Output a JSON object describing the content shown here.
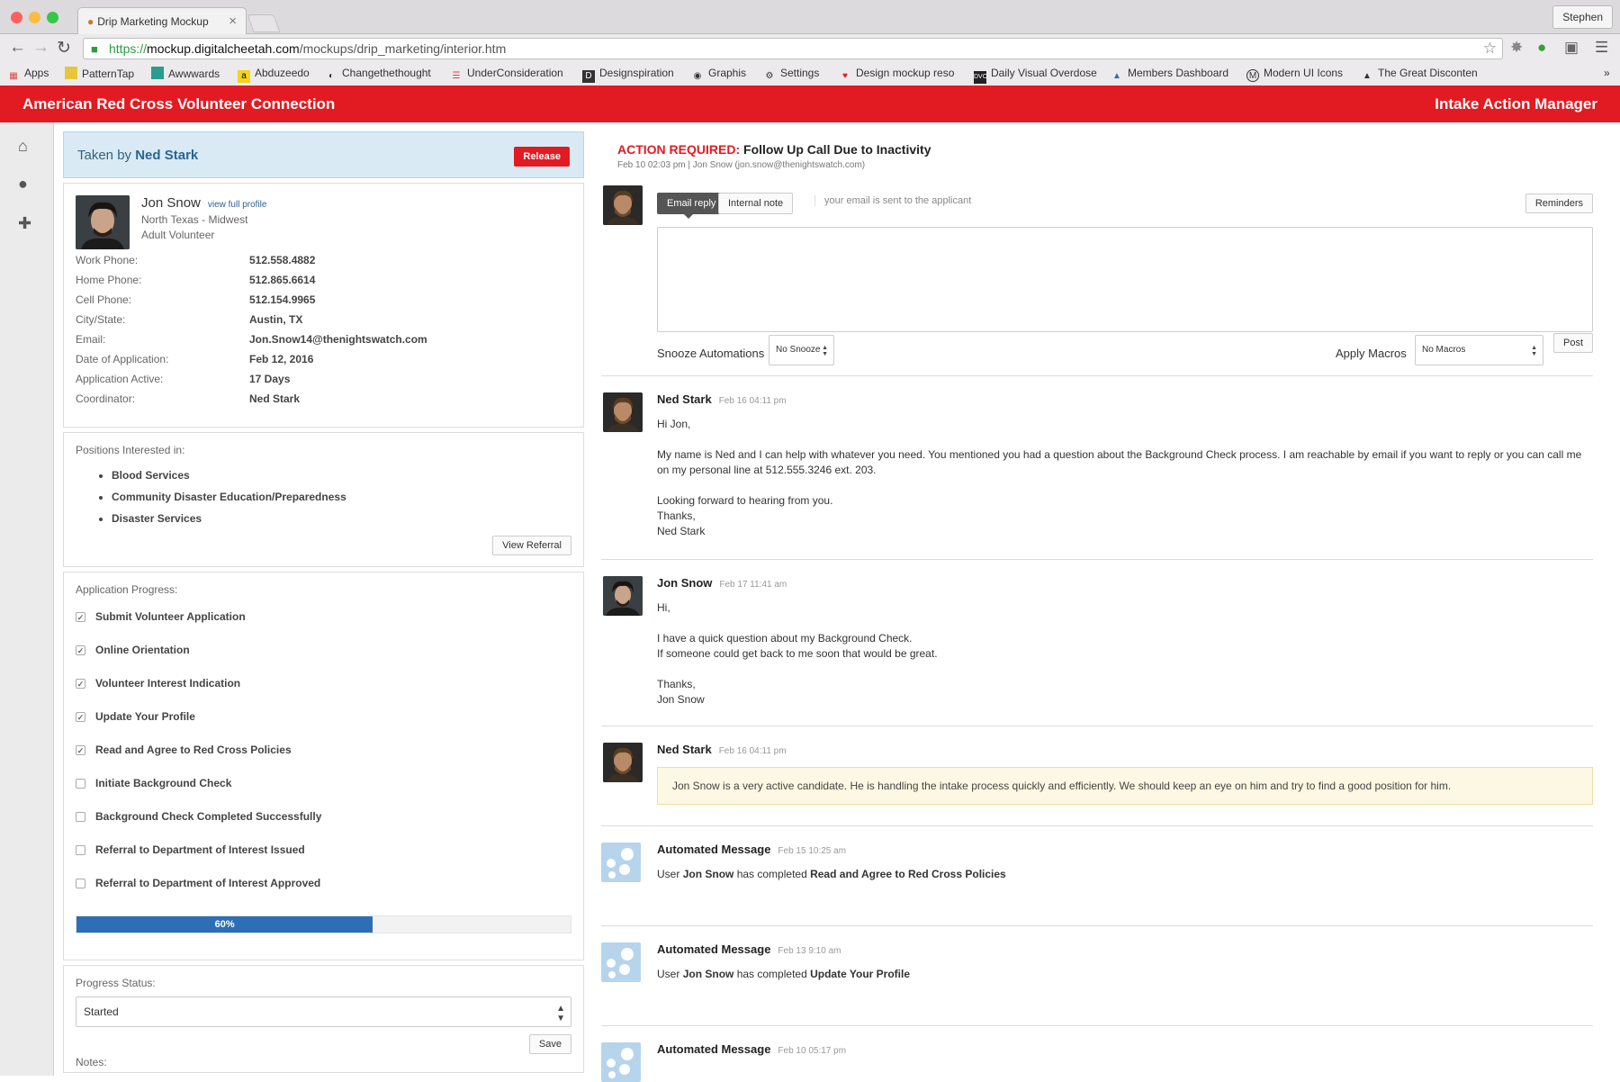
{
  "browser": {
    "tab_title": "Drip Marketing Mockup",
    "user_button": "Stephen",
    "url_scheme": "https://",
    "url_domain": "mockup.digitalcheetah.com",
    "url_path": "/mockups/drip_marketing/interior.htm",
    "bookmarks": [
      "Apps",
      "PatternTap",
      "Awwwards",
      "Abduzeedo",
      "Changethethought",
      "UnderConsideration",
      "Designspiration",
      "Graphis",
      "Settings",
      "Design mockup reso",
      "Daily Visual Overdose",
      "Members Dashboard",
      "Modern UI Icons",
      "The Great Disconten"
    ],
    "bookmarks_more": "»"
  },
  "app": {
    "title": "American Red Cross Volunteer Connection",
    "module": "Intake Action Manager"
  },
  "taken": {
    "prefix": "Taken by",
    "name": "Ned Stark",
    "release_label": "Release"
  },
  "applicant": {
    "name": "Jon Snow",
    "view_profile": "view full profile",
    "region": "North Texas - Midwest",
    "role": "Adult Volunteer",
    "fields": [
      {
        "label": "Work Phone:",
        "value": "512.558.4882"
      },
      {
        "label": "Home Phone:",
        "value": "512.865.6614"
      },
      {
        "label": "Cell Phone:",
        "value": "512.154.9965"
      },
      {
        "label": "City/State:",
        "value": "Austin, TX"
      },
      {
        "label": "Email:",
        "value": "Jon.Snow14@thenightswatch.com"
      },
      {
        "label": "Date of Application:",
        "value": "Feb 12, 2016"
      },
      {
        "label": "Application Active:",
        "value": "17 Days"
      },
      {
        "label": "Coordinator:",
        "value": "Ned Stark"
      }
    ]
  },
  "positions": {
    "title": "Positions Interested in:",
    "items": [
      "Blood Services",
      "Community Disaster Education/Preparedness",
      "Disaster Services"
    ],
    "button": "View Referral"
  },
  "progress": {
    "title": "Application Progress:",
    "steps": [
      {
        "label": "Submit Volunteer Application",
        "checked": true
      },
      {
        "label": "Online Orientation",
        "checked": true
      },
      {
        "label": "Volunteer Interest Indication",
        "checked": true
      },
      {
        "label": "Update Your Profile",
        "checked": true
      },
      {
        "label": "Read and Agree to Red Cross Policies",
        "checked": true
      },
      {
        "label": "Initiate Background Check",
        "checked": false
      },
      {
        "label": "Background Check Completed Successfully",
        "checked": false
      },
      {
        "label": "Referral to Department of Interest Issued",
        "checked": false
      },
      {
        "label": "Referral to Department of Interest Approved",
        "checked": false
      }
    ],
    "percent": 60,
    "percent_label": "60%"
  },
  "status": {
    "title": "Progress Status:",
    "selected": "Started",
    "save_label": "Save",
    "notes_label": "Notes:"
  },
  "action": {
    "prefix": "ACTION REQUIRED:",
    "title": "Follow Up Call Due to Inactivity",
    "meta": "Feb 10 02:03 pm | Jon Snow (jon.snow@thenightswatch.com)"
  },
  "compose": {
    "email_tab": "Email reply",
    "note_tab": "Internal note",
    "hint": "your email is sent to the applicant",
    "reminders": "Reminders",
    "snooze_label": "Snooze Automations",
    "snooze_value": "No Snooze",
    "macros_label": "Apply Macros",
    "macros_value": "No Macros",
    "post": "Post"
  },
  "messages": [
    {
      "author": "Ned Stark",
      "time": "Feb 16 04:11 pm",
      "paras": [
        "Hi Jon,",
        "My name is Ned and I can help with whatever you need. You mentioned you had a question about the Background Check process. I am reachable by email if you want to reply or you can call me on my personal line at 512.555.3246 ext. 203.",
        "Looking forward to hearing from you.\nThanks,\nNed Stark"
      ]
    },
    {
      "author": "Jon Snow",
      "time": "Feb 17 11:41 am",
      "paras": [
        "Hi,",
        "I have a quick question about my Background Check.\nIf someone could get back to me soon that would be great.",
        "Thanks,\nJon Snow"
      ]
    },
    {
      "author": "Ned Stark",
      "time": "Feb 16 04:11 pm",
      "note": "Jon Snow is a very active candidate. He is handling the intake process quickly and efficiently. We should keep an eye on him and try to find a good position for him."
    }
  ],
  "automated": [
    {
      "author": "Automated Message",
      "time": "Feb 15 10:25 am",
      "pre": "User",
      "user": "Jon Snow",
      "mid": "has completed",
      "item": "Read and Agree to Red Cross Policies"
    },
    {
      "author": "Automated Message",
      "time": "Feb 13 9:10 am",
      "pre": "User",
      "user": "Jon Snow",
      "mid": "has completed",
      "item": "Update Your Profile"
    },
    {
      "author": "Automated Message",
      "time": "Feb 10 05:17 pm"
    }
  ]
}
